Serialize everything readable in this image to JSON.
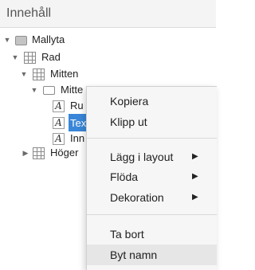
{
  "panel": {
    "title": "Innehåll"
  },
  "tree": {
    "mallyta": "Mallyta",
    "rad": "Rad",
    "mitten": "Mitten",
    "mitten_child": "Mitte",
    "rubrik": "Ru",
    "text": "Tex",
    "innehall": "Inn",
    "hoger": "Höger",
    "selected": "text"
  },
  "context_menu": {
    "kopiera": "Kopiera",
    "klipp_ut": "Klipp ut",
    "lagg_i_layout": "Lägg i layout",
    "floda": "Flöda",
    "dekoration": "Dekoration",
    "ta_bort": "Ta bort",
    "byt_namn": "Byt namn",
    "hovered": "byt_namn"
  },
  "icons": {
    "expanded": "triangle-down",
    "collapsed": "triangle-right",
    "submenu": "triangle-right"
  }
}
